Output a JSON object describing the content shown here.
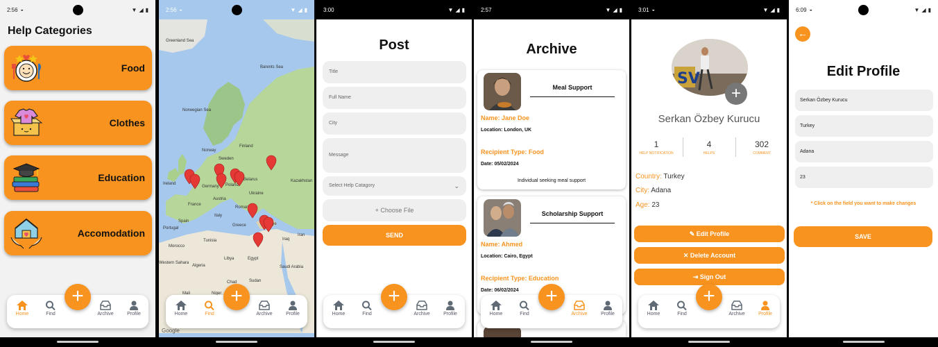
{
  "screens": {
    "home": {
      "time": "2:56",
      "title": "Help Categories",
      "categories": [
        {
          "label": "Food",
          "icon": "food-icon"
        },
        {
          "label": "Clothes",
          "icon": "clothes-icon"
        },
        {
          "label": "Education",
          "icon": "education-icon"
        },
        {
          "label": "Accomodation",
          "icon": "accomodation-icon"
        }
      ]
    },
    "find": {
      "time": "2:56",
      "map_labels": [
        "Greenland Sea",
        "Barents Sea",
        "Norwegian Sea",
        "Finland",
        "Sweden",
        "Norway",
        "Ireland",
        "Belarus",
        "Germany",
        "Poland",
        "Ukraine",
        "France",
        "Austria",
        "Romania",
        "Spain",
        "Italy",
        "Portugal",
        "Greece",
        "Türkiye",
        "Morocco",
        "Tunisia",
        "Algeria",
        "Libya",
        "Egypt",
        "Western Sahara",
        "Mali",
        "Niger",
        "Sudan",
        "Chad",
        "Saudi Arabia",
        "Iran",
        "Iraq",
        "Kazakhstan",
        "Google"
      ]
    },
    "post": {
      "time": "3:00",
      "title": "Post",
      "placeholders": {
        "title": "Title",
        "full_name": "Full Name",
        "city": "City",
        "message": "Message",
        "select": "Select Help Catagory",
        "file": "Choose File"
      },
      "send": "SEND"
    },
    "archive": {
      "time": "2:57",
      "title": "Archive",
      "cards": [
        {
          "title": "Meal Support",
          "name": "Name: Jane Doe",
          "location": "Location: London, UK",
          "recipient": "Recipient Type: Food",
          "date": "Date: 05/02/2024",
          "desc": "Individual seeking meal support"
        },
        {
          "title": "Scholarship Support",
          "name": "Name: Ahmed",
          "location": "Location: Cairo, Egypt",
          "recipient": "Recipient Type: Education",
          "date": "Date: 06/02/2024"
        }
      ]
    },
    "profile": {
      "time": "3:01",
      "name": "Serkan Özbey Kurucu",
      "stats": [
        {
          "value": "1",
          "label": "HELP NOTIFICATION"
        },
        {
          "value": "4",
          "label": "HELPS"
        },
        {
          "value": "302",
          "label": "COMMENT"
        }
      ],
      "country_key": "Country:",
      "country": "Turkey",
      "city_key": "City:",
      "city": "Adana",
      "age_key": "Age:",
      "age": "23",
      "edit": "Edit Profile",
      "delete": "Delete Account",
      "signout": "Sign Out"
    },
    "edit": {
      "time": "6:09",
      "title": "Edit Profile",
      "fields": [
        "Serkan Özbey Kurucu",
        "Turkey",
        "Adana",
        "23"
      ],
      "hint": "* Click on the field you want to make changes",
      "save": "SAVE"
    }
  },
  "nav": {
    "home": "Home",
    "find": "Find",
    "archive": "Archive",
    "profile": "Profile"
  },
  "colors": {
    "accent": "#f7931e",
    "pin": "#e53935",
    "nav_icon": "#5f6a75"
  }
}
